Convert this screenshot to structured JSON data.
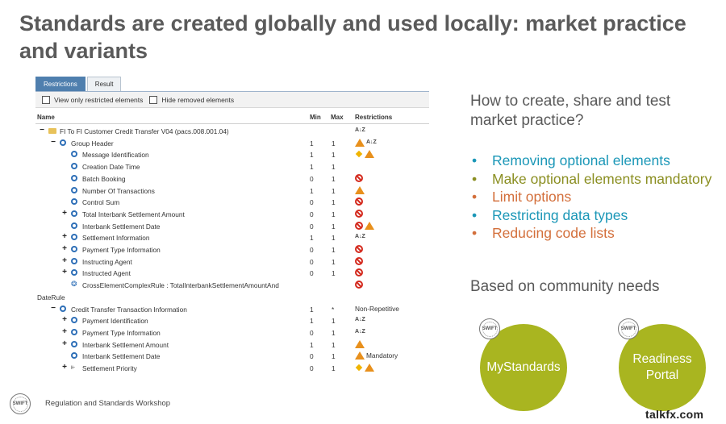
{
  "title": "Standards are created globally and used locally: market practice and variants",
  "tabs": [
    "Restrictions",
    "Result"
  ],
  "filters": [
    "View only restricted elements",
    "Hide removed elements"
  ],
  "columns": {
    "name": "Name",
    "min": "Min",
    "max": "Max",
    "restrictions": "Restrictions"
  },
  "rows": [
    {
      "name": "FI To FI Customer Credit Transfer V04 (pacs.008.001.04)",
      "min": "",
      "max": "",
      "restr": "",
      "level": 0,
      "toggle": "minus",
      "icon": "folder",
      "marks": [
        "az"
      ]
    },
    {
      "name": "Group Header",
      "min": "1",
      "max": "1",
      "restr": "",
      "level": 1,
      "toggle": "minus",
      "icon": "element",
      "marks": [
        "warn",
        "az"
      ]
    },
    {
      "name": "Message Identification",
      "min": "1",
      "max": "1",
      "restr": "",
      "level": 2,
      "toggle": "",
      "icon": "element",
      "marks": [
        "dia",
        "warn"
      ]
    },
    {
      "name": "Creation Date Time",
      "min": "1",
      "max": "1",
      "restr": "",
      "level": 2,
      "toggle": "",
      "icon": "element",
      "marks": []
    },
    {
      "name": "Batch Booking",
      "min": "0",
      "max": "1",
      "restr": "",
      "level": 2,
      "toggle": "",
      "icon": "element",
      "marks": [
        "no"
      ]
    },
    {
      "name": "Number Of Transactions",
      "min": "1",
      "max": "1",
      "restr": "",
      "level": 2,
      "toggle": "",
      "icon": "element",
      "marks": [
        "warn"
      ]
    },
    {
      "name": "Control Sum",
      "min": "0",
      "max": "1",
      "restr": "",
      "level": 2,
      "toggle": "",
      "icon": "element",
      "marks": [
        "no"
      ]
    },
    {
      "name": "Total Interbank Settlement Amount",
      "min": "0",
      "max": "1",
      "restr": "",
      "level": 2,
      "toggle": "plus",
      "icon": "element",
      "marks": [
        "no"
      ]
    },
    {
      "name": "Interbank Settlement Date",
      "min": "0",
      "max": "1",
      "restr": "",
      "level": 2,
      "toggle": "",
      "icon": "element",
      "marks": [
        "no",
        "warn"
      ]
    },
    {
      "name": "Settlement Information",
      "min": "1",
      "max": "1",
      "restr": "",
      "level": 2,
      "toggle": "plus",
      "icon": "element",
      "marks": [
        "az"
      ]
    },
    {
      "name": "Payment Type Information",
      "min": "0",
      "max": "1",
      "restr": "",
      "level": 2,
      "toggle": "plus",
      "icon": "element",
      "marks": [
        "no"
      ]
    },
    {
      "name": "Instructing Agent",
      "min": "0",
      "max": "1",
      "restr": "",
      "level": 2,
      "toggle": "plus",
      "icon": "element",
      "marks": [
        "no"
      ]
    },
    {
      "name": "Instructed Agent",
      "min": "0",
      "max": "1",
      "restr": "",
      "level": 2,
      "toggle": "plus",
      "icon": "element",
      "marks": [
        "no"
      ]
    },
    {
      "name": "CrossElementComplexRule : TotalInterbankSettlementAmountAnd",
      "min": "",
      "max": "",
      "restr": "",
      "level": 2,
      "toggle": "",
      "icon": "rule",
      "marks": [
        "no"
      ]
    },
    {
      "name": "DateRule",
      "min": "",
      "max": "",
      "restr": "",
      "level": -1,
      "toggle": "",
      "icon": "",
      "marks": []
    },
    {
      "name": "Credit Transfer Transaction Information",
      "min": "1",
      "max": "*",
      "restr": "Non-Repetitive",
      "level": 1,
      "toggle": "minus",
      "icon": "element",
      "marks": []
    },
    {
      "name": "Payment Identification",
      "min": "1",
      "max": "1",
      "restr": "",
      "level": 2,
      "toggle": "plus",
      "icon": "element",
      "marks": [
        "az"
      ]
    },
    {
      "name": "Payment Type Information",
      "min": "0",
      "max": "1",
      "restr": "",
      "level": 2,
      "toggle": "plus",
      "icon": "element",
      "marks": [
        "az"
      ]
    },
    {
      "name": "Interbank Settlement Amount",
      "min": "1",
      "max": "1",
      "restr": "",
      "level": 2,
      "toggle": "plus",
      "icon": "element",
      "marks": [
        "warn"
      ]
    },
    {
      "name": "Interbank Settlement Date",
      "min": "0",
      "max": "1",
      "restr": "Mandatory",
      "level": 2,
      "toggle": "",
      "icon": "element",
      "marks": [
        "warn"
      ]
    },
    {
      "name": "Settlement Priority",
      "min": "0",
      "max": "1",
      "restr": "",
      "level": 2,
      "toggle": "plus",
      "icon": "choice",
      "marks": [
        "dia",
        "warn"
      ]
    }
  ],
  "right": {
    "question": "How to create, share and test market practice?",
    "bullets": [
      {
        "text": "Removing optional elements",
        "color": "#1b97b7"
      },
      {
        "text": "Make optional elements mandatory",
        "color": "#8b8f22"
      },
      {
        "text": "Limit options",
        "color": "#d36f3b"
      },
      {
        "text": "Restricting data types",
        "color": "#1b97b7"
      },
      {
        "text": "Reducing code lists",
        "color": "#d36f3b"
      }
    ],
    "based": "Based on community needs",
    "circles": [
      "MyStandards",
      "Readiness Portal"
    ],
    "badge": "SWIFT"
  },
  "footer": "Regulation and Standards Workshop",
  "watermark": "talkfx.com"
}
